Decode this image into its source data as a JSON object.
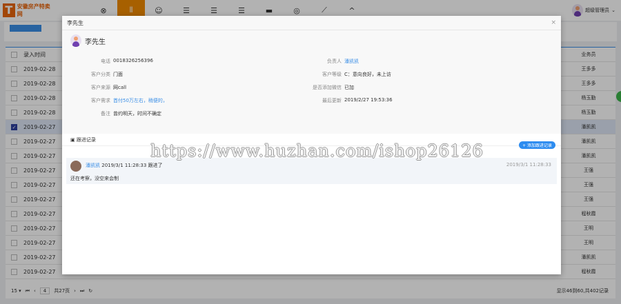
{
  "brand": {
    "logo_letter": "T",
    "name": "安徽房产特卖网"
  },
  "nav": [
    "⊗",
    "⫴",
    "☺",
    "☰",
    "☰",
    "☰",
    "▬",
    "◎",
    "⟋",
    "^"
  ],
  "user": {
    "name": "超级管理员"
  },
  "table": {
    "header_date": "录入时间",
    "header_owner": "业务员",
    "rows": [
      {
        "date": "2019-02-28",
        "owner": "王多多",
        "checked": false
      },
      {
        "date": "2019-02-28",
        "owner": "王多多",
        "checked": false
      },
      {
        "date": "2019-02-28",
        "owner": "杨玉勤",
        "checked": false
      },
      {
        "date": "2019-02-28",
        "owner": "杨玉勤",
        "checked": false
      },
      {
        "date": "2019-02-27",
        "owner": "潘凯凯",
        "checked": true
      },
      {
        "date": "2019-02-27",
        "owner": "潘凯凯",
        "checked": false
      },
      {
        "date": "2019-02-27",
        "owner": "潘凯凯",
        "checked": false
      },
      {
        "date": "2019-02-27",
        "owner": "王强",
        "checked": false
      },
      {
        "date": "2019-02-27",
        "owner": "王强",
        "checked": false
      },
      {
        "date": "2019-02-27",
        "owner": "王强",
        "checked": false
      },
      {
        "date": "2019-02-27",
        "owner": "程秋霞",
        "checked": false
      },
      {
        "date": "2019-02-27",
        "owner": "王明",
        "checked": false
      },
      {
        "date": "2019-02-27",
        "owner": "王明",
        "checked": false
      },
      {
        "date": "2019-02-27",
        "owner": "潘凯凯",
        "checked": false
      },
      {
        "date": "2019-02-27",
        "owner": "程秋霞",
        "checked": false
      }
    ]
  },
  "pager": {
    "size": "15 ▾",
    "page": "4",
    "total": "共27页",
    "summary": "显示46到60,共402记录"
  },
  "modal": {
    "title": "李先生",
    "close": "×",
    "name": "李先生",
    "fields": {
      "phone_l": "电话",
      "phone": "0018326256396",
      "owner_l": "负责人",
      "owner": "潘凯凯",
      "type_l": "客户分类",
      "type": "门面",
      "level_l": "客户等级",
      "level": "C：意向良好，未上访",
      "source_l": "客户来源",
      "source": "网call",
      "wechat_l": "是否添加微信",
      "wechat": "已加",
      "need_l": "客户需求",
      "need": "首付50万左右，稍便的，",
      "update_l": "最后更新",
      "update": "2019/2/27 19:53:36",
      "remark_l": "备注",
      "remark": "曾约明天，时间不确定"
    },
    "section": "跟进记录",
    "add_btn": "+ 添加跟进记录",
    "record": {
      "user": "潘凯凯",
      "meta": "2019/3/1 11:28:33 跟进了",
      "time": "2019/3/1 11:28:33",
      "note": "还在考察，没空来会制"
    }
  },
  "watermark": "https://www.huzhan.com/ishop26126"
}
